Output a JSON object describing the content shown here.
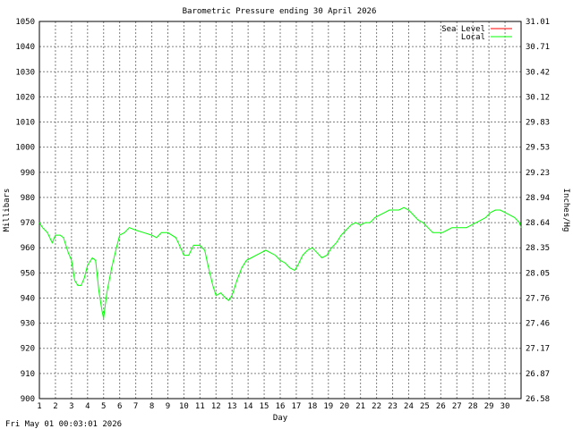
{
  "chart_data": {
    "type": "line",
    "title": "Barometric Pressure ending 30 April 2026",
    "xlabel": "Day",
    "ylabel_left": "Millibars",
    "ylabel_right": "Inches/Hg",
    "footer": "Fri May 01 00:03:01 2026",
    "xlim": [
      1,
      31
    ],
    "ylim": [
      900,
      1050
    ],
    "x_ticks": [
      1,
      2,
      3,
      4,
      5,
      6,
      7,
      8,
      9,
      10,
      11,
      12,
      13,
      14,
      15,
      16,
      17,
      18,
      19,
      20,
      21,
      22,
      23,
      24,
      25,
      26,
      27,
      28,
      29,
      30
    ],
    "y_ticks_left": [
      900,
      910,
      920,
      930,
      940,
      950,
      960,
      970,
      980,
      990,
      1000,
      1010,
      1020,
      1030,
      1040,
      1050
    ],
    "y_ticks_right": [
      "26.58",
      "26.87",
      "27.17",
      "27.46",
      "27.76",
      "28.05",
      "28.35",
      "28.64",
      "28.94",
      "29.23",
      "29.53",
      "29.83",
      "30.12",
      "30.42",
      "30.71",
      "31.01"
    ],
    "grid": true,
    "legend_position": "top-right",
    "colors": {
      "background": "#ffffff",
      "grid": "#808080",
      "axes": "#000000"
    },
    "series": [
      {
        "name": "Sea Level",
        "color": "#ff0000",
        "values": []
      },
      {
        "name": "Local",
        "color": "#00ff00",
        "values": [
          [
            1.0,
            970
          ],
          [
            1.2,
            968
          ],
          [
            1.5,
            966
          ],
          [
            1.8,
            962
          ],
          [
            2.0,
            965
          ],
          [
            2.3,
            965
          ],
          [
            2.5,
            964
          ],
          [
            2.8,
            958
          ],
          [
            3.0,
            955
          ],
          [
            3.2,
            947
          ],
          [
            3.4,
            945
          ],
          [
            3.6,
            945
          ],
          [
            3.8,
            948
          ],
          [
            4.0,
            953
          ],
          [
            4.3,
            956
          ],
          [
            4.5,
            955
          ],
          [
            4.7,
            943
          ],
          [
            4.9,
            935
          ],
          [
            5.0,
            932
          ],
          [
            5.2,
            942
          ],
          [
            5.5,
            952
          ],
          [
            5.8,
            960
          ],
          [
            6.0,
            965
          ],
          [
            6.3,
            966
          ],
          [
            6.6,
            968
          ],
          [
            7.0,
            967
          ],
          [
            7.5,
            966
          ],
          [
            8.0,
            965
          ],
          [
            8.3,
            964
          ],
          [
            8.6,
            966
          ],
          [
            9.0,
            966
          ],
          [
            9.5,
            964
          ],
          [
            9.8,
            960
          ],
          [
            10.0,
            957
          ],
          [
            10.3,
            957
          ],
          [
            10.6,
            961
          ],
          [
            11.0,
            961
          ],
          [
            11.3,
            959
          ],
          [
            11.5,
            953
          ],
          [
            11.8,
            945
          ],
          [
            12.0,
            941
          ],
          [
            12.3,
            942
          ],
          [
            12.6,
            940
          ],
          [
            12.8,
            939
          ],
          [
            13.0,
            941
          ],
          [
            13.3,
            947
          ],
          [
            13.6,
            952
          ],
          [
            13.9,
            955
          ],
          [
            14.2,
            956
          ],
          [
            14.5,
            957
          ],
          [
            14.8,
            958
          ],
          [
            15.1,
            959
          ],
          [
            15.4,
            958
          ],
          [
            15.7,
            957
          ],
          [
            16.0,
            955
          ],
          [
            16.3,
            954
          ],
          [
            16.6,
            952
          ],
          [
            16.9,
            951
          ],
          [
            17.1,
            953
          ],
          [
            17.4,
            957
          ],
          [
            17.7,
            959
          ],
          [
            18.0,
            960
          ],
          [
            18.3,
            958
          ],
          [
            18.6,
            956
          ],
          [
            18.9,
            957
          ],
          [
            19.2,
            960
          ],
          [
            19.5,
            962
          ],
          [
            19.8,
            965
          ],
          [
            20.1,
            967
          ],
          [
            20.4,
            969
          ],
          [
            20.7,
            970
          ],
          [
            21.0,
            969
          ],
          [
            21.3,
            970
          ],
          [
            21.6,
            970
          ],
          [
            21.9,
            972
          ],
          [
            22.2,
            973
          ],
          [
            22.5,
            974
          ],
          [
            22.8,
            975
          ],
          [
            23.1,
            975
          ],
          [
            23.4,
            975
          ],
          [
            23.7,
            976
          ],
          [
            24.0,
            975
          ],
          [
            24.3,
            973
          ],
          [
            24.6,
            971
          ],
          [
            24.9,
            970
          ],
          [
            25.2,
            968
          ],
          [
            25.5,
            966
          ],
          [
            25.8,
            966
          ],
          [
            26.1,
            966
          ],
          [
            26.4,
            967
          ],
          [
            26.7,
            968
          ],
          [
            27.0,
            968
          ],
          [
            27.3,
            968
          ],
          [
            27.6,
            968
          ],
          [
            27.9,
            969
          ],
          [
            28.2,
            970
          ],
          [
            28.5,
            971
          ],
          [
            28.8,
            972
          ],
          [
            29.1,
            974
          ],
          [
            29.4,
            975
          ],
          [
            29.7,
            975
          ],
          [
            30.0,
            974
          ],
          [
            30.3,
            973
          ],
          [
            30.6,
            972
          ],
          [
            30.9,
            970
          ],
          [
            31.0,
            968
          ]
        ]
      }
    ]
  }
}
